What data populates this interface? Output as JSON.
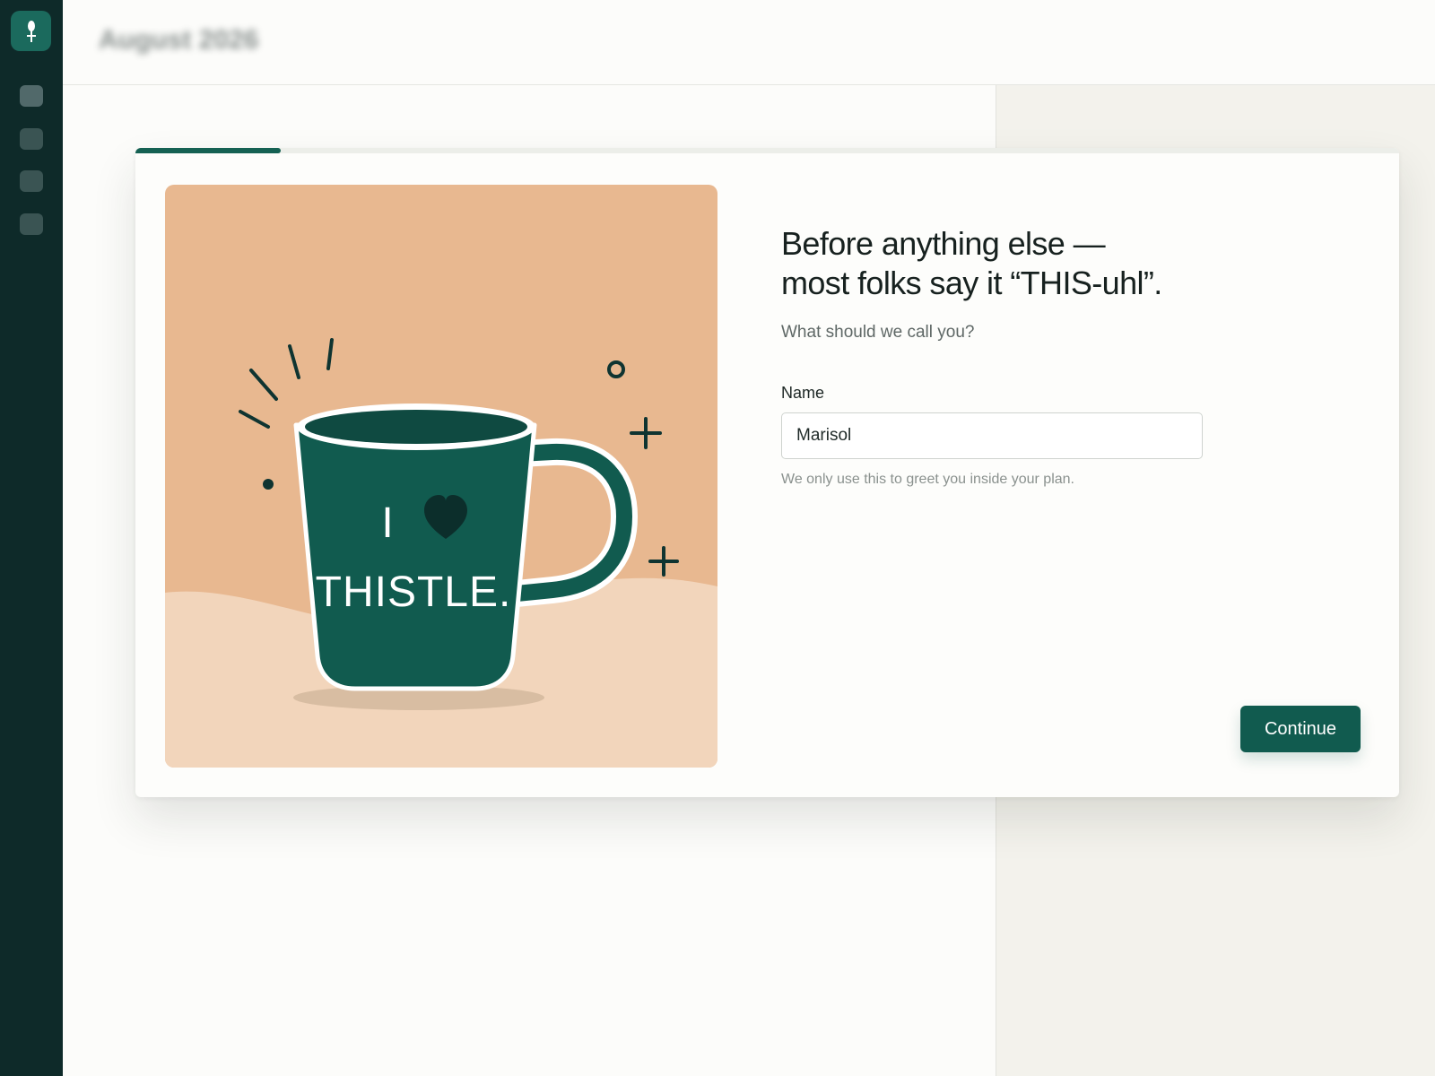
{
  "colors": {
    "sidebar": "#0e2a29",
    "accent": "#115b4f",
    "illustration_bg": "#e8b890",
    "illustration_ground": "#f2d5bb",
    "mug": "#115b4f"
  },
  "sidebar": {
    "logo_icon": "thistle-logo-icon",
    "items": [
      {
        "icon": "nav-icon-1"
      },
      {
        "icon": "nav-icon-2"
      },
      {
        "icon": "nav-icon-3"
      },
      {
        "icon": "nav-icon-4"
      }
    ]
  },
  "background_page": {
    "title": "August 2026"
  },
  "onboarding": {
    "progress": 0.115,
    "illustration": {
      "mug_line1": "I",
      "mug_line2": "THISTLE."
    },
    "headline_line1": "Before anything else —",
    "headline_line2": "most folks say it “THIS-uhl”.",
    "subtitle": "What should we call you?",
    "name_label": "Name",
    "name_value": "Marisol",
    "helper": "We only use this to greet you inside your plan.",
    "continue_label": "Continue"
  }
}
